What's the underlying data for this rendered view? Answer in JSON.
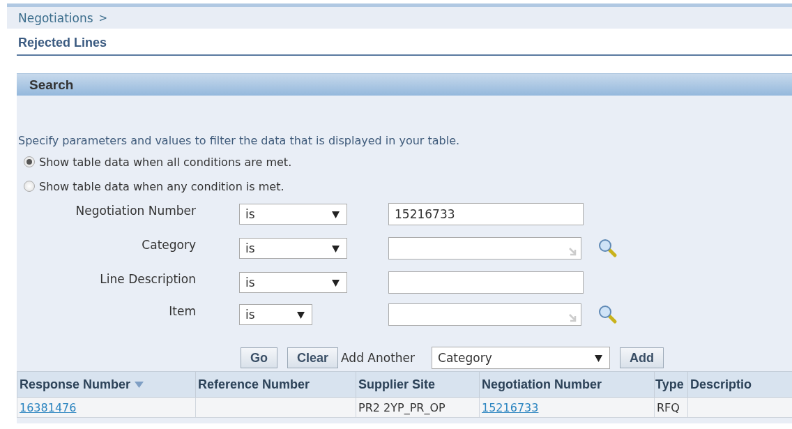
{
  "breadcrumb": {
    "label": "Negotiations",
    "separator": ">"
  },
  "page_title": "Rejected Lines",
  "search": {
    "title": "Search",
    "instruction": "Specify parameters and values to filter the data that is displayed in your table.",
    "match_options": [
      {
        "label": "Show table data when all conditions are met.",
        "selected": true
      },
      {
        "label": "Show table data when any condition is met.",
        "selected": false
      }
    ],
    "criteria": [
      {
        "label": "Negotiation Number",
        "operator": "is",
        "value": "15216733",
        "kind": "text"
      },
      {
        "label": "Category",
        "operator": "is",
        "kind": "lov"
      },
      {
        "label": "Line Description",
        "operator": "is",
        "kind": "text"
      },
      {
        "label": "Item",
        "operator": "is",
        "kind": "lov"
      }
    ],
    "buttons": [
      "Go",
      "Clear"
    ],
    "add_another": {
      "label": "Add Another",
      "value": "Category",
      "button": "Add"
    }
  },
  "table": {
    "columns": [
      {
        "label": "Response Number",
        "sorted": true
      },
      {
        "label": "Reference Number",
        "sorted": false
      },
      {
        "label": "Supplier Site",
        "sorted": false
      },
      {
        "label": "Negotiation Number",
        "sorted": false
      },
      {
        "label": "Type",
        "sorted": false
      },
      {
        "label": "Descriptio",
        "sorted": false
      }
    ],
    "rows": [
      {
        "cells": [
          {
            "text": "16381476",
            "kind": "link"
          },
          {
            "kind": "text"
          },
          {
            "text": "PR2 2YP_PR_OP",
            "kind": "text"
          },
          {
            "text": "15216733",
            "kind": "link"
          },
          {
            "text": "RFQ",
            "kind": "text"
          },
          {
            "kind": "text"
          }
        ]
      }
    ]
  }
}
